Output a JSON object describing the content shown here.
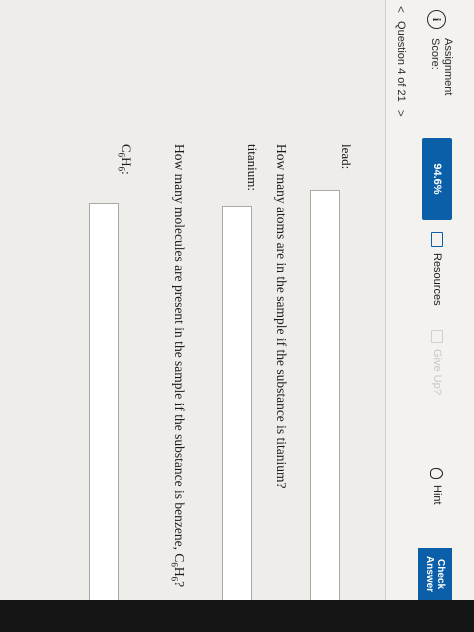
{
  "header": {
    "score_label": "Assignment Score:",
    "score_value": "94.6%",
    "resources_label": "Resources",
    "giveup_label": "Give Up?",
    "hint_label": "Hint",
    "check_label": "Check Answer"
  },
  "nav": {
    "prev": "<",
    "question_label": "Question 4 of 21",
    "next": ">"
  },
  "fields": {
    "lead_label": "lead:",
    "q_atoms": "How many atoms are in the sample if the substance is titanium?",
    "titanium_label": "titanium:",
    "q_molecules_prefix": "How many molecules are present in the sample if the substance is benzene, C",
    "q_molecules_sub1": "6",
    "q_molecules_mid": "H",
    "q_molecules_sub2": "6",
    "q_molecules_suffix": "?",
    "benzene_c": "C",
    "benzene_sub1": "6",
    "benzene_h": "H",
    "benzene_sub2": "6",
    "benzene_colon": ":"
  }
}
